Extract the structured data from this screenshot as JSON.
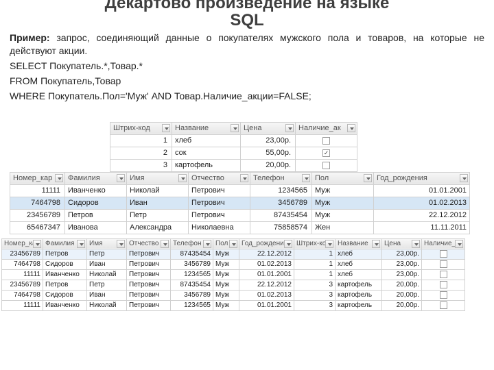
{
  "title_line1": "Декартово произведение на языке",
  "title_line2": "SQL",
  "intro_label": "Пример:",
  "intro_text": " запрос, соединяющий данные о покупателях мужского пола и товаров, на которые не действуют акции.",
  "sql1": "SELECT Покупатель.*,Товар.*",
  "sql2": "FROM Покупатель,Товар",
  "sql3": "WHERE Покупатель.Пол='Муж' AND Товар.Наличие_акции=FALSE;",
  "t1_headers": [
    "Штрих-код",
    "Название",
    "Цена",
    "Наличие_ак"
  ],
  "t1_rows": [
    {
      "code": "1",
      "name": "хлеб",
      "price": "23,00р.",
      "promo": false
    },
    {
      "code": "2",
      "name": "сок",
      "price": "55,00р.",
      "promo": true
    },
    {
      "code": "3",
      "name": "картофель",
      "price": "20,00р.",
      "promo": false
    }
  ],
  "t2_headers": [
    "Номер_кар",
    "Фамилия",
    "Имя",
    "Отчество",
    "Телефон",
    "Пол",
    "Год_рождения"
  ],
  "t2_rows": [
    {
      "card": "11111",
      "fam": "Иванченко",
      "name": "Николай",
      "otch": "Петрович",
      "tel": "1234565",
      "pol": "Муж",
      "god": "01.01.2001",
      "hi": false
    },
    {
      "card": "7464798",
      "fam": "Сидоров",
      "name": "Иван",
      "otch": "Петрович",
      "tel": "3456789",
      "pol": "Муж",
      "god": "01.02.2013",
      "hi": true
    },
    {
      "card": "23456789",
      "fam": "Петров",
      "name": "Петр",
      "otch": "Петрович",
      "tel": "87435454",
      "pol": "Муж",
      "god": "22.12.2012",
      "hi": false
    },
    {
      "card": "65467347",
      "fam": "Иванова",
      "name": "Александра",
      "otch": "Николаевна",
      "tel": "75858574",
      "pol": "Жен",
      "god": "11.11.2011",
      "hi": false
    }
  ],
  "t3_headers": [
    "Номер_кар",
    "Фамилия",
    "Имя",
    "Отчество",
    "Телефон",
    "Пол",
    "Год_рождения",
    "Штрих-код",
    "Название",
    "Цена",
    "Наличие_ак"
  ],
  "t3_rows": [
    {
      "card": "23456789",
      "fam": "Петров",
      "name": "Петр",
      "otch": "Петрович",
      "tel": "87435454",
      "pol": "Муж",
      "god": "22.12.2012",
      "bc": "1",
      "tov": "хлеб",
      "price": "23,00р.",
      "promo": false,
      "hi": true
    },
    {
      "card": "7464798",
      "fam": "Сидоров",
      "name": "Иван",
      "otch": "Петрович",
      "tel": "3456789",
      "pol": "Муж",
      "god": "01.02.2013",
      "bc": "1",
      "tov": "хлеб",
      "price": "23,00р.",
      "promo": false,
      "hi": false
    },
    {
      "card": "11111",
      "fam": "Иванченко",
      "name": "Николай",
      "otch": "Петрович",
      "tel": "1234565",
      "pol": "Муж",
      "god": "01.01.2001",
      "bc": "1",
      "tov": "хлеб",
      "price": "23,00р.",
      "promo": false,
      "hi": false
    },
    {
      "card": "23456789",
      "fam": "Петров",
      "name": "Петр",
      "otch": "Петрович",
      "tel": "87435454",
      "pol": "Муж",
      "god": "22.12.2012",
      "bc": "3",
      "tov": "картофель",
      "price": "20,00р.",
      "promo": false,
      "hi": false
    },
    {
      "card": "7464798",
      "fam": "Сидоров",
      "name": "Иван",
      "otch": "Петрович",
      "tel": "3456789",
      "pol": "Муж",
      "god": "01.02.2013",
      "bc": "3",
      "tov": "картофель",
      "price": "20,00р.",
      "promo": false,
      "hi": false
    },
    {
      "card": "11111",
      "fam": "Иванченко",
      "name": "Николай",
      "otch": "Петрович",
      "tel": "1234565",
      "pol": "Муж",
      "god": "01.01.2001",
      "bc": "3",
      "tov": "картофель",
      "price": "20,00р.",
      "promo": false,
      "hi": false
    }
  ]
}
